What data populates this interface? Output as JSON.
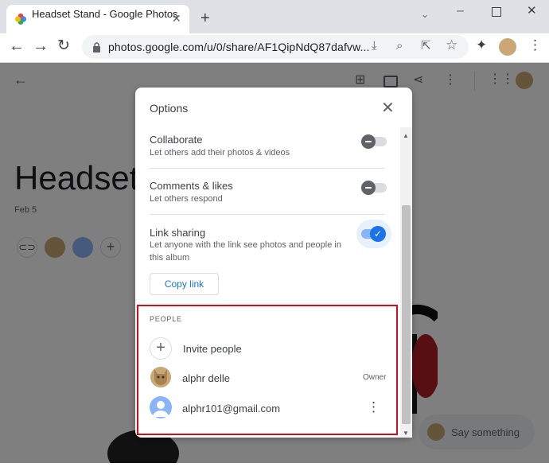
{
  "browser": {
    "tab_title": "Headset Stand - Google Photos",
    "url": "photos.google.com/u/0/share/AF1QipNdQ87dafvw..."
  },
  "album": {
    "title": "Headset",
    "date": "Feb 5",
    "comment_placeholder": "Say something"
  },
  "dialog": {
    "title": "Options",
    "options": [
      {
        "title": "Collaborate",
        "subtitle": "Let others add their photos & videos",
        "enabled": false
      },
      {
        "title": "Comments & likes",
        "subtitle": "Let others respond",
        "enabled": false
      },
      {
        "title": "Link sharing",
        "subtitle": "Let anyone with the link see photos and people in this album",
        "enabled": true
      }
    ],
    "copy_link_label": "Copy link",
    "people_header": "PEOPLE",
    "invite_label": "Invite people",
    "people": [
      {
        "name": "alphr delle",
        "role": "Owner"
      },
      {
        "name": "alphr101@gmail.com",
        "role": ""
      }
    ]
  },
  "colors": {
    "accent": "#1a73e8",
    "highlight_box": "#d40d1c"
  },
  "icons": [
    "photos-logo-icon",
    "close-icon",
    "new-tab-icon",
    "back-arrow-icon",
    "forward-arrow-icon",
    "refresh-icon",
    "lock-icon",
    "install-icon",
    "zoom-icon",
    "share-icon",
    "star-icon",
    "extensions-icon",
    "profile-avatar",
    "add-photo-icon",
    "slideshow-icon",
    "more-vert-icon",
    "apps-grid-icon",
    "link-icon",
    "plus-icon",
    "person-icon",
    "minimize-icon",
    "maximize-icon",
    "chevron-down-icon"
  ]
}
